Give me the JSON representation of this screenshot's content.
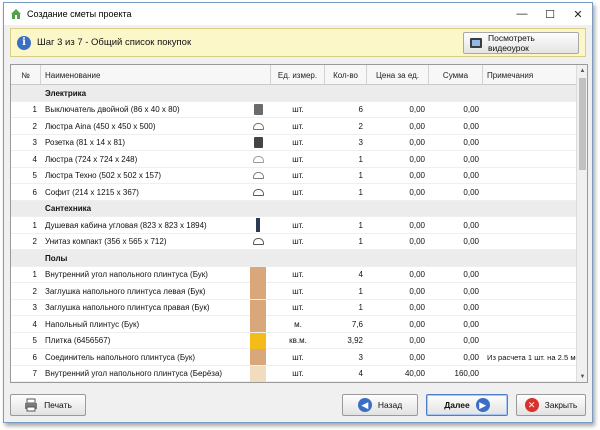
{
  "window": {
    "title": "Создание сметы проекта",
    "controls": [
      "—",
      "☐",
      "✕"
    ]
  },
  "step": {
    "text": "Шаг 3 из 7 - Общий список покупок",
    "video_button": "Посмотреть видеоурок"
  },
  "table": {
    "headers": {
      "num": "№",
      "name": "Наименование",
      "unit": "Ед. измер.",
      "qty": "Кол-во",
      "price": "Цена за ед.",
      "sum": "Сумма",
      "note": "Примечания"
    },
    "rows": [
      {
        "type": "group",
        "label": "Электрика"
      },
      {
        "type": "item",
        "num": "1",
        "name": "Выключатель двойной (86 x 40 x 80)",
        "icon": "switch-icon",
        "color": "#6b6b6b",
        "unit": "шт.",
        "qty": "6",
        "price": "0,00",
        "sum": "0,00",
        "note": ""
      },
      {
        "type": "item",
        "num": "2",
        "name": "Люстра Aina (450 x 450 x 500)",
        "icon": "chandelier-icon",
        "color": "#8a6a4a",
        "unit": "шт.",
        "qty": "2",
        "price": "0,00",
        "sum": "0,00",
        "note": ""
      },
      {
        "type": "item",
        "num": "3",
        "name": "Розетка (81 x 14 x 81)",
        "icon": "socket-icon",
        "color": "#444444",
        "unit": "шт.",
        "qty": "3",
        "price": "0,00",
        "sum": "0,00",
        "note": ""
      },
      {
        "type": "item",
        "num": "4",
        "name": "Люстра (724 x 724 x 248)",
        "icon": "chandelier-icon",
        "color": "#9a9a9a",
        "unit": "шт.",
        "qty": "1",
        "price": "0,00",
        "sum": "0,00",
        "note": ""
      },
      {
        "type": "item",
        "num": "5",
        "name": "Люстра Техно (502 x 502 x 157)",
        "icon": "chandelier-icon",
        "color": "#7a7a7a",
        "unit": "шт.",
        "qty": "1",
        "price": "0,00",
        "sum": "0,00",
        "note": ""
      },
      {
        "type": "item",
        "num": "6",
        "name": "Софит (214 x 1215 x 367)",
        "icon": "spotlight-icon",
        "color": "#5a5a5a",
        "unit": "шт.",
        "qty": "1",
        "price": "0,00",
        "sum": "0,00",
        "note": ""
      },
      {
        "type": "group",
        "label": "Сантехника"
      },
      {
        "type": "item",
        "num": "1",
        "name": "Душевая кабина угловая (823 x 823 x 1894)",
        "icon": "shower-icon",
        "color": "#2e3a52",
        "unit": "шт.",
        "qty": "1",
        "price": "0,00",
        "sum": "0,00",
        "note": ""
      },
      {
        "type": "item",
        "num": "2",
        "name": "Унитаз компакт (356 x 565 x 712)",
        "icon": "toilet-icon",
        "color": "#555555",
        "unit": "шт.",
        "qty": "1",
        "price": "0,00",
        "sum": "0,00",
        "note": ""
      },
      {
        "type": "group",
        "label": "Полы"
      },
      {
        "type": "item",
        "num": "1",
        "name": "Внутренний угол напольного плинтуса (Бук)",
        "icon": "wood-swatch-icon",
        "color": "#d8a77a",
        "unit": "шт.",
        "qty": "4",
        "price": "0,00",
        "sum": "0,00",
        "note": ""
      },
      {
        "type": "item",
        "num": "2",
        "name": "Заглушка напольного плинтуса левая (Бук)",
        "icon": "wood-swatch-icon",
        "color": "#d8a77a",
        "unit": "шт.",
        "qty": "1",
        "price": "0,00",
        "sum": "0,00",
        "note": ""
      },
      {
        "type": "item",
        "num": "3",
        "name": "Заглушка напольного плинтуса правая (Бук)",
        "icon": "wood-swatch-icon",
        "color": "#d8a77a",
        "unit": "шт.",
        "qty": "1",
        "price": "0,00",
        "sum": "0,00",
        "note": ""
      },
      {
        "type": "item",
        "num": "4",
        "name": "Напольный плинтус (Бук)",
        "icon": "wood-swatch-icon",
        "color": "#d8a77a",
        "unit": "м.",
        "qty": "7,6",
        "price": "0,00",
        "sum": "0,00",
        "note": ""
      },
      {
        "type": "item",
        "num": "5",
        "name": "Плитка (6456567)",
        "icon": "tile-swatch-icon",
        "color": "#f3bc18",
        "unit": "кв.м.",
        "qty": "3,92",
        "price": "0,00",
        "sum": "0,00",
        "note": ""
      },
      {
        "type": "item",
        "num": "6",
        "name": "Соединитель напольного плинтуса (Бук)",
        "icon": "wood-swatch-icon",
        "color": "#d8a77a",
        "unit": "шт.",
        "qty": "3",
        "price": "0,00",
        "sum": "0,00",
        "note": "Из расчета 1 шт. на 2.5 метра"
      },
      {
        "type": "item",
        "num": "7",
        "name": "Внутренний угол напольного плинтуса (Берёза)",
        "icon": "wood-swatch-icon",
        "color": "#f1dcc0",
        "unit": "шт.",
        "qty": "4",
        "price": "40,00",
        "sum": "160,00",
        "note": ""
      },
      {
        "type": "item",
        "num": "8",
        "name": "Заглушка напольного плинтуса левая (Берёза)",
        "icon": "wood-swatch-icon",
        "color": "#f1dcc0",
        "unit": "шт.",
        "qty": "4",
        "price": "50,00",
        "sum": "200,00",
        "note": ""
      }
    ]
  },
  "footer": {
    "print": "Печать",
    "back": "Назад",
    "next": "Далее",
    "close": "Закрыть"
  },
  "colors": {
    "accent": "#3b6fc4",
    "stepbar": "#fbf7c8",
    "close_red": "#d9312b"
  }
}
